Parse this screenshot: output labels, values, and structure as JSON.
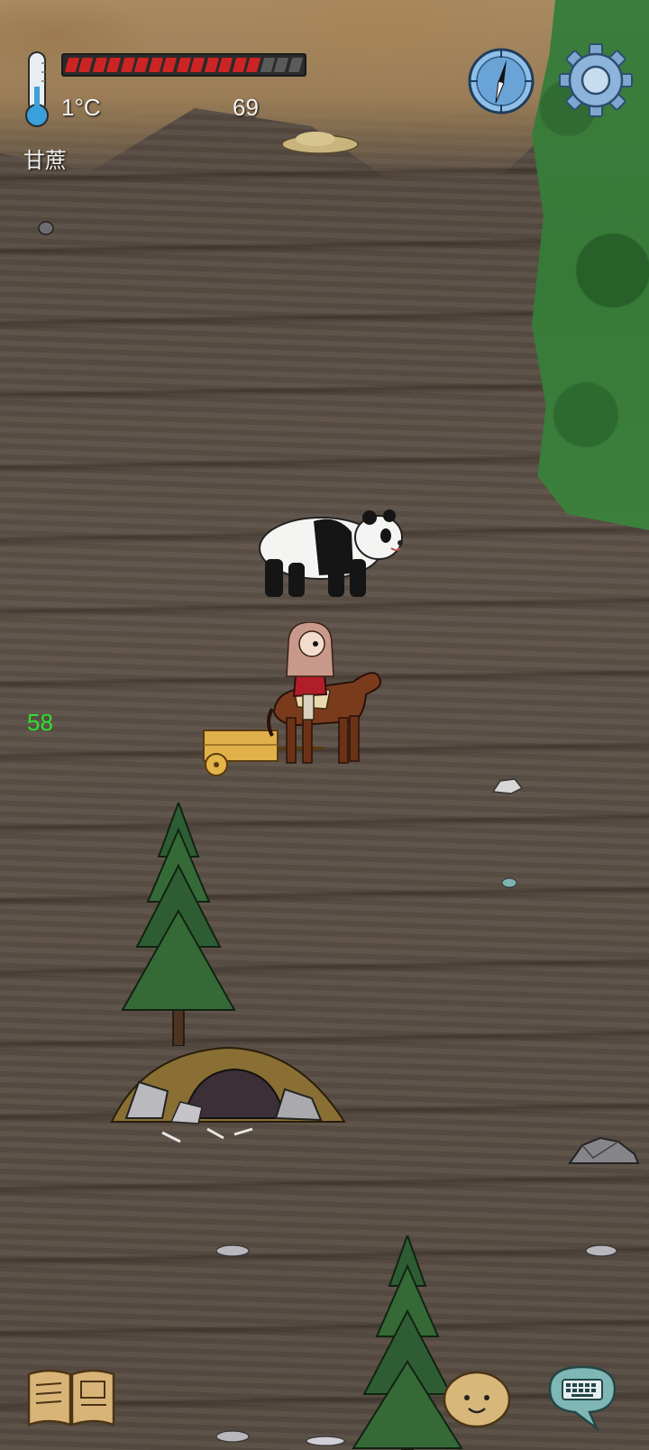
{
  "hud": {
    "temperature": "1°C",
    "food_value": "69",
    "food_bar": {
      "filled_segments": 14,
      "total_segments": 17
    },
    "held_item": "甘蔗",
    "fps": "58"
  },
  "colors": {
    "food_fill": "#cc2424",
    "food_empty": "#5a5a5a",
    "fps_text": "#2ee02e",
    "hud_text": "#f2f2f2",
    "forest": "#3b7d3c",
    "ground": "#5a4f46"
  },
  "icons": {
    "thermometer": "thermometer-icon",
    "compass": "compass-icon",
    "settings": "gear-icon",
    "tech_book": "book-icon",
    "emote": "emote-face-icon",
    "chat": "keyboard-chat-icon"
  },
  "world": {
    "entities": [
      "panda",
      "player-on-horse",
      "cart",
      "pine-tree",
      "bear-cave",
      "boulder",
      "stones",
      "dry-grass-pile"
    ]
  }
}
